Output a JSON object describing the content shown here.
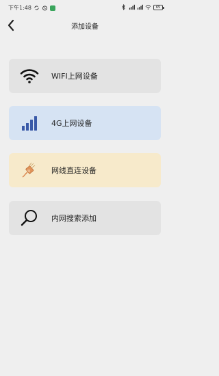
{
  "status_bar": {
    "time": "下午1:48",
    "battery": "65"
  },
  "header": {
    "title": "添加设备"
  },
  "options": [
    {
      "label": "WIFI上网设备",
      "icon": "wifi-icon",
      "bg": "#e3e3e3"
    },
    {
      "label": "4G上网设备",
      "icon": "signal-bars-icon",
      "bg": "#d6e3f3"
    },
    {
      "label": "网线直连设备",
      "icon": "ethernet-cable-icon",
      "bg": "#f7eacb"
    },
    {
      "label": "内网搜索添加",
      "icon": "search-icon",
      "bg": "#e3e3e3"
    }
  ],
  "colors": {
    "background": "#efefef",
    "signal_blue": "#3a5aa8",
    "cable_orange": "#d9824a"
  }
}
